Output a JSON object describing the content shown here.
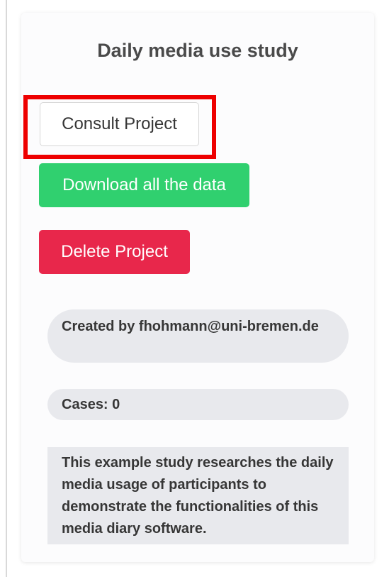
{
  "project": {
    "title": "Daily media use study",
    "created_by": "Created by fhohmann@uni-bremen.de",
    "cases": "Cases: 0",
    "description": "This example study researches the daily media usage of participants to demonstrate the functionalities of this media diary software."
  },
  "actions": {
    "consult_label": "Consult Project",
    "download_label": "Download all the data",
    "delete_label": "Delete Project"
  },
  "colors": {
    "highlight": "#ee0000",
    "download": "#30d06f",
    "delete": "#e8274b",
    "pill_background": "#e8e9ed"
  }
}
